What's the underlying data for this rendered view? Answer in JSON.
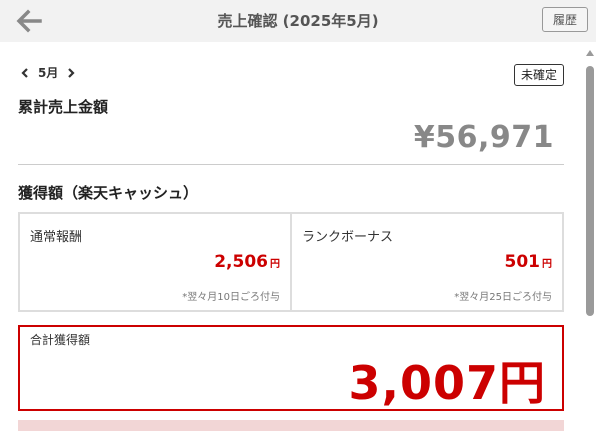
{
  "header": {
    "title": "売上確認 (2025年5月)",
    "history_label": "履歴"
  },
  "month_nav": {
    "label": "5月"
  },
  "status_badge": "未確定",
  "cumulative": {
    "label": "累計売上金額",
    "amount": "¥56,971"
  },
  "earned": {
    "label": "獲得額（楽天キャッシュ）",
    "cells": [
      {
        "title": "通常報酬",
        "amount": "2,506",
        "unit": "円",
        "note": "*翌々月10日ごろ付与"
      },
      {
        "title": "ランクボーナス",
        "amount": "501",
        "unit": "円",
        "note": "*翌々月25日ごろ付与"
      }
    ]
  },
  "total": {
    "label": "合計獲得額",
    "amount": "3,007円"
  },
  "colors": {
    "accent": "#cc0000",
    "header_bg": "#f2f2f2",
    "muted_amount": "#888888"
  }
}
